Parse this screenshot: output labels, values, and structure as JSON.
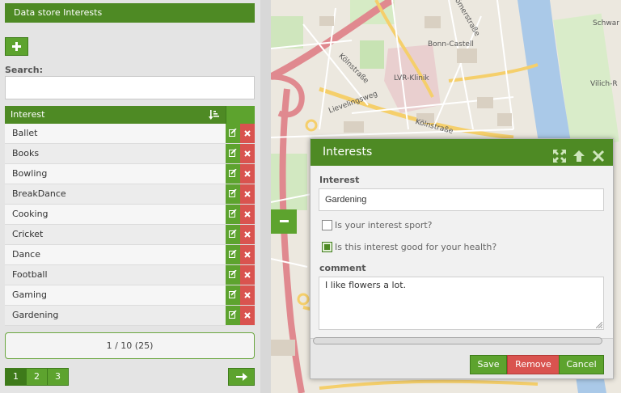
{
  "left_panel": {
    "title": "Data store Interests",
    "add_icon": "plus-icon",
    "search": {
      "label": "Search:",
      "value": ""
    },
    "grid": {
      "column_header": "Interest",
      "sort_icon": "sort-ascending-icon",
      "edit_icon": "edit-icon",
      "delete_icon": "delete-icon",
      "rows": [
        "Ballet",
        "Books",
        "Bowling",
        "BreakDance",
        "Cooking",
        "Cricket",
        "Dance",
        "Football",
        "Gaming",
        "Gardening"
      ]
    },
    "pager_info": "1 / 10 (25)",
    "pages": [
      "1",
      "2",
      "3"
    ],
    "active_page": "1",
    "next_icon": "arrow-right-icon"
  },
  "map": {
    "labels": {
      "bonn_castell": "Bonn-Castell",
      "lvr_klinik": "LVR-Klinik",
      "kolnstrasse_1": "Kölnstraße",
      "kolnstrasse_2": "Kölnstraße",
      "lievelingsweg": "Lievelingsweg",
      "romerstrasse": "Römerstraße",
      "schwarz": "Schwar",
      "vilich": "Vilich-R"
    },
    "collapse_icon": "minus-icon",
    "colors": {
      "land": "#ece8df",
      "river": "#aac9e8",
      "highway": "#e0898f",
      "road": "#f5cf6b",
      "park": "#c7e3b3"
    }
  },
  "dialog": {
    "title": "Interests",
    "tools": [
      "maximize-icon",
      "arrow-up-icon",
      "close-icon"
    ],
    "interest_label": "Interest",
    "interest_value": "Gardening",
    "checkbox_sport": {
      "label": "Is your interest sport?",
      "checked": false
    },
    "checkbox_health": {
      "label": "Is this interest good for your health?",
      "checked": true
    },
    "comment_label": "comment",
    "comment_value": "I like flowers a lot.",
    "buttons": {
      "save": "Save",
      "remove": "Remove",
      "cancel": "Cancel"
    }
  },
  "colors": {
    "accent_green": "#4e8a24",
    "button_green": "#5da32e",
    "danger_red": "#d9534f"
  }
}
